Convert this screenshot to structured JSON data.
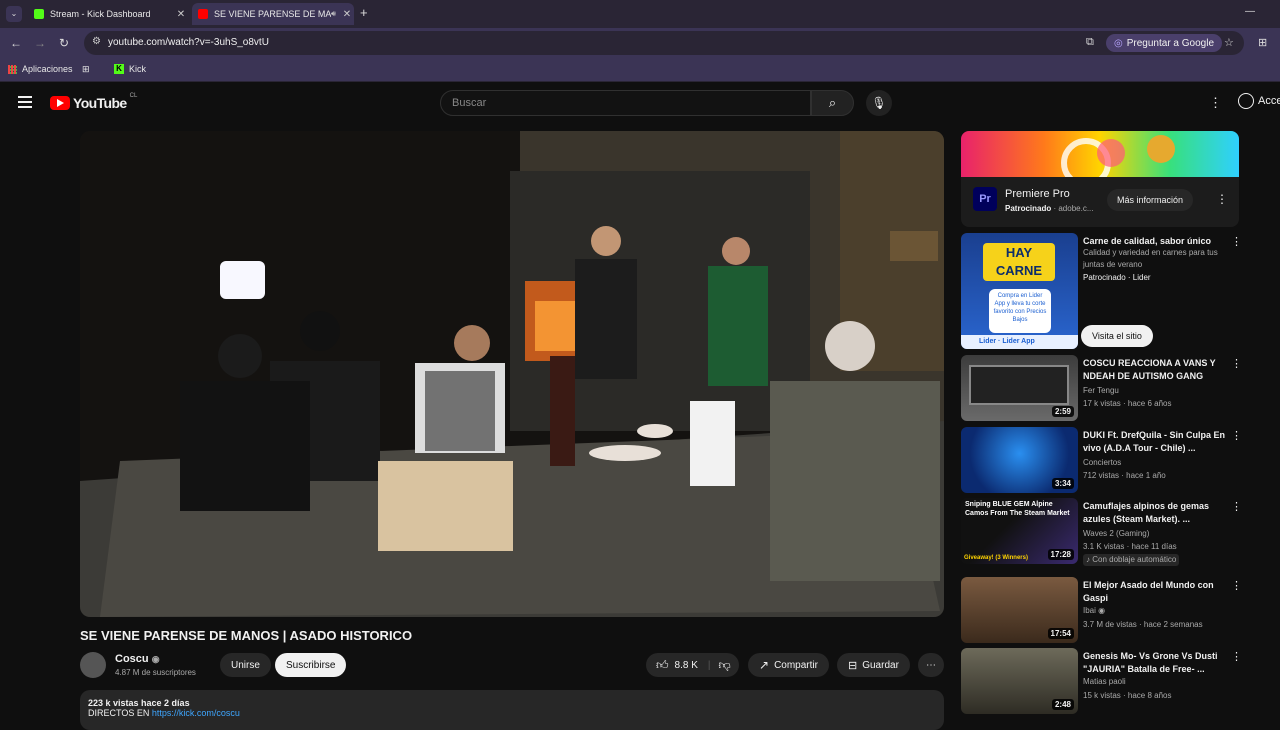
{
  "browser": {
    "tabs": [
      {
        "title": "Stream - Kick Dashboard",
        "active": false
      },
      {
        "title": "SE VIENE PARENSE DE MANOS | ASADO HISTORICO - YouTube",
        "active": true
      }
    ],
    "url": "youtube.com/watch?v=-3uhS_o8vtU",
    "gemini_label": "Preguntar a Google",
    "bookmarks": [
      "Aplicaciones",
      "Kick"
    ]
  },
  "youtube": {
    "logo_text": "YouTube",
    "country": "CL",
    "search_placeholder": "Buscar",
    "signin_label": "Acceder"
  },
  "video": {
    "title": "SE VIENE PARENSE DE MANOS | ASADO HISTORICO",
    "channel": "Coscu",
    "subscribers": "4.87 M de suscriptores",
    "join_label": "Unirse",
    "subscribe_label": "Suscribirse",
    "likes": "8.8 K",
    "share_label": "Compartir",
    "save_label": "Guardar",
    "stats": "223 k vistas  hace 2 días",
    "desc_prefix": "DIRECTOS EN",
    "desc_link": "https://kick.com/coscu"
  },
  "ad": {
    "name": "Premiere Pro",
    "sponsored": "Patrocinado",
    "domain": "adobe.c...",
    "cta": "Más información",
    "icon_text": "Pr"
  },
  "recommendations": [
    {
      "title": "Carne de calidad, sabor único",
      "meta1": "Calidad y variedad en carnes para tus juntas de verano",
      "meta2": "Patrocinado · Lider",
      "duration": "",
      "cta": "Visita el sitio",
      "thumb_text": "HAY CARNE",
      "thumb_sub": "Compra en Lider App y lleva tu corte favorito con Precios Bajos",
      "thumb_brand": "Lider · Lider App"
    },
    {
      "title": "COSCU REACCIONA A VANS Y NDEAH DE AUTISMO GANG",
      "meta1": "Fer Tengu",
      "meta2": "17 k vistas · hace 6 años",
      "duration": "2:59"
    },
    {
      "title": "DUKI Ft. DrefQuila - Sin Culpa En vivo (A.D.A Tour - Chile) ...",
      "meta1": "Conciertos",
      "meta2": "712 vistas · hace 1 año",
      "duration": "3:34"
    },
    {
      "title": "Camuflajes alpinos de gemas azules (Steam Market). ...",
      "meta1": "Waves 2 (Gaming)",
      "meta2": "3.1 K vistas · hace 11 días",
      "meta3": "Con doblaje automático",
      "duration": "17:28",
      "thumb_text": "Sniping BLUE GEM Alpine Camos From The Steam Market",
      "thumb_sub": "Giveaway! (3 Winners)"
    },
    {
      "title": "El Mejor Asado del Mundo con Gaspi",
      "meta1": "Ibai",
      "meta2": "3.7 M de vistas · hace 2 semanas",
      "duration": "17:54"
    },
    {
      "title": "Genesis Mo- Vs Grone Vs Dusti \"JAURIA\" Batalla de Free- ...",
      "meta1": "Matias paoli",
      "meta2": "15 k vistas · hace 8 años",
      "duration": "2:48"
    }
  ]
}
